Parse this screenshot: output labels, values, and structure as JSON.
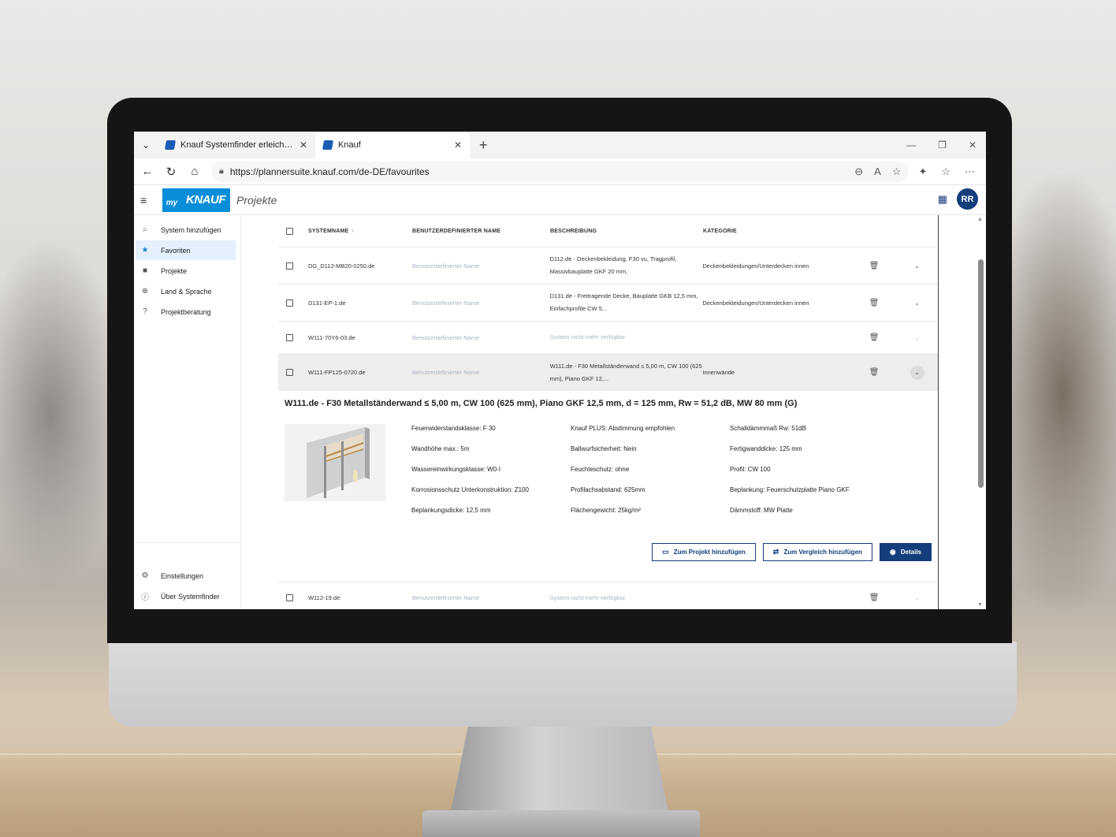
{
  "browser": {
    "tabs": [
      {
        "label": "Knauf Systemfinder erleichtert die"
      },
      {
        "label": "Knauf"
      }
    ],
    "url": "https://plannersuite.knauf.com/de-DE/favourites"
  },
  "app": {
    "logo_my": "my",
    "logo_brand": "KNAUF",
    "logo_section": "Projekte",
    "avatar": "RR"
  },
  "sidebar": {
    "items": [
      {
        "label": "System hinzufügen",
        "icon": "search-icon"
      },
      {
        "label": "Favoriten",
        "icon": "star-icon"
      },
      {
        "label": "Projekte",
        "icon": "folder-icon"
      },
      {
        "label": "Land & Sprache",
        "icon": "globe-icon"
      },
      {
        "label": "Projektberatung",
        "icon": "help-icon"
      }
    ],
    "bottom": [
      {
        "label": "Einstellungen",
        "icon": "gear-icon"
      },
      {
        "label": "Über Systemfinder",
        "icon": "info-icon"
      }
    ]
  },
  "table": {
    "headers": {
      "system": "SYSTEMNAME",
      "custom": "BENUTZERDEFINIERTER NAME",
      "desc": "BESCHREIBUNG",
      "category": "KATEGORIE"
    },
    "rows": [
      {
        "system": "DG_D112-MB20-0250.de",
        "custom": "Benutzerdefinierter Name",
        "desc": "D112.de - Deckenbekleidung, F30 vu, Tragprofil, Massivbauplatte GKF 20 mm,",
        "category": "Deckenbekleidungen/Unterdecken innen"
      },
      {
        "system": "D131-EP-1.de",
        "custom": "Benutzerdefinierter Name",
        "desc": "D131.de - Freitragende Decke, Bauplatte GKB 12,5 mm, Einfachprofile CW 5...",
        "category": "Deckenbekleidungen/Unterdecken innen"
      },
      {
        "system": "W111-70Y6-03.de",
        "custom": "Benutzerdefinierter Name",
        "desc": "System nicht mehr verfügbar",
        "category": ""
      },
      {
        "system": "W111-FP125-0720.de",
        "custom": "Benutzerdefinierter Name",
        "desc": "W111.de - F30 Metallständerwand ≤ 5,00 m, CW 100 (625 mm), Piano GKF 12,...",
        "category": "Innenwände"
      },
      {
        "system": "W112-19.de",
        "custom": "Benutzerdefinierter Name",
        "desc": "System nicht mehr verfügbar",
        "category": ""
      }
    ]
  },
  "detail": {
    "title": "W111.de - F30 Metallständerwand ≤ 5,00 m, CW 100 (625 mm), Piano GKF 12,5 mm, d = 125 mm, Rw = 51,2 dB, MW 80 mm (G)",
    "specs": [
      "Feuerwiderstandsklasse: F 30",
      "Knauf PLUS: Abstimmung empfohlen",
      "Schalldämmmaß Rw: 51dB",
      "Wandhöhe max.: 5m",
      "Ballwurfsicherheit: Nein",
      "Fertigwanddicke: 125 mm",
      "Wassereinwirkungsklasse: W0-I",
      "Feuchteschutz: ohne",
      "Profil: CW 100",
      "Korrosionsschutz Unterkonstruktion: Z100",
      "Profilachsabstand: 625mm",
      "Beplankung: Feuerschutzplatte Piano GKF",
      "Beplankungsdicke: 12,5 mm",
      "Flächengewicht: 25kg/m²",
      "Dämmstoff: MW Platte"
    ],
    "buttons": {
      "project": "Zum Projekt hinzufügen",
      "compare": "Zum Vergleich hinzufügen",
      "details": "Details"
    }
  }
}
